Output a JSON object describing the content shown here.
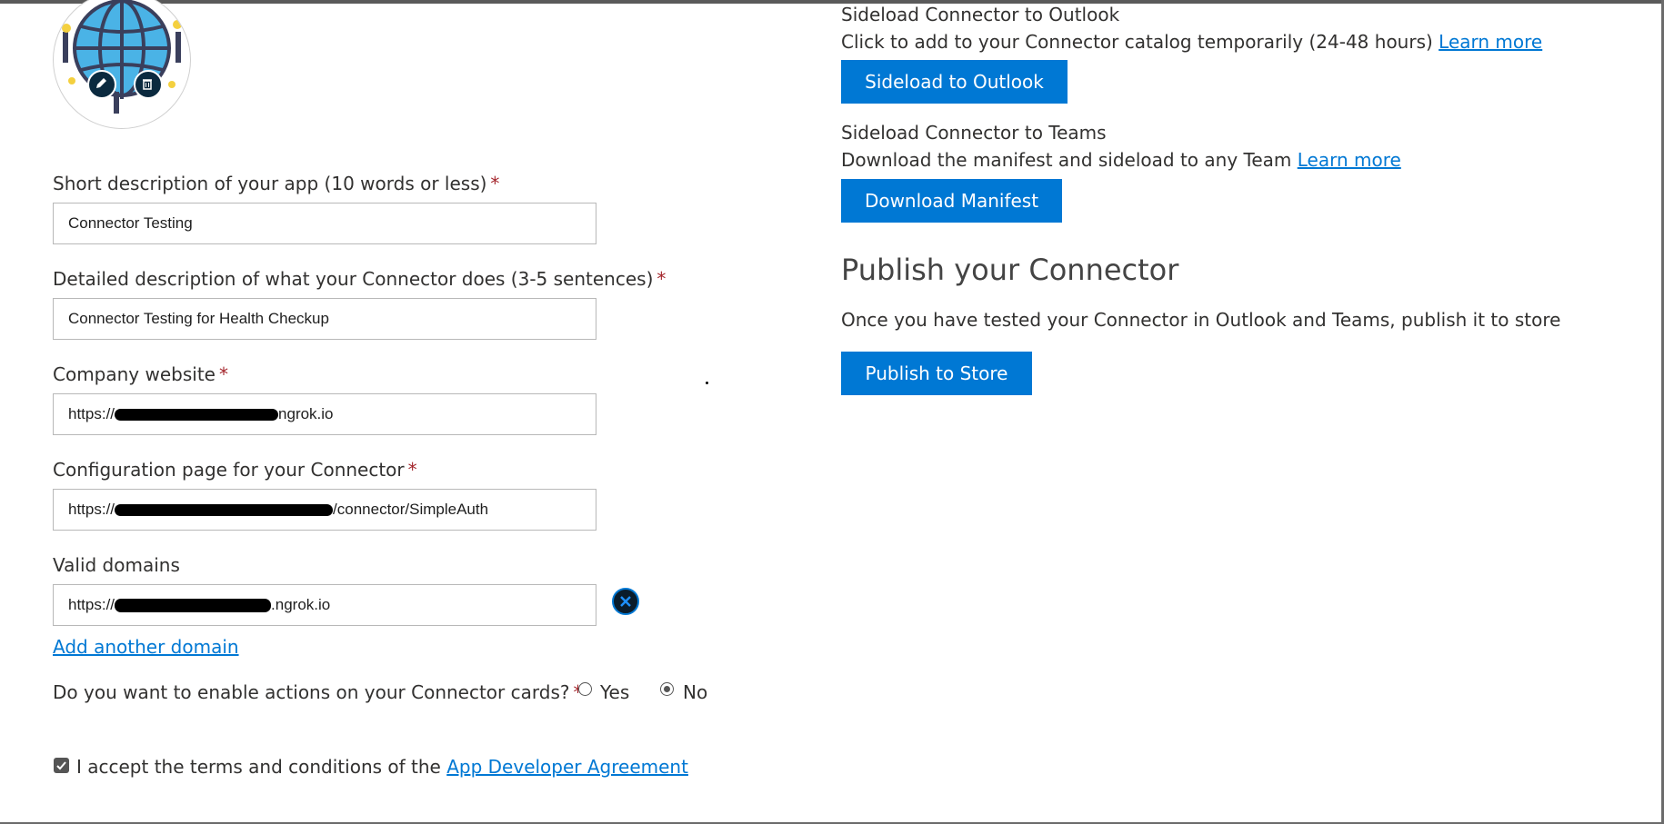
{
  "avatar": {
    "edit_icon": "pencil-icon",
    "delete_icon": "trash-icon"
  },
  "form": {
    "short_description": {
      "label": "Short description of your app (10 words or less)",
      "required": "*",
      "value": "Connector Testing"
    },
    "detailed_description": {
      "label": "Detailed description of what your Connector does (3-5 sentences)",
      "required": "*",
      "value": "Connector Testing for Health Checkup"
    },
    "company_website": {
      "label": "Company website",
      "required": "*",
      "prefix": "https://",
      "suffix": "ngrok.io"
    },
    "configuration_page": {
      "label": "Configuration page for your Connector",
      "required": "*",
      "prefix": "https://",
      "suffix": "/connector/SimpleAuth"
    },
    "valid_domains": {
      "label": "Valid domains",
      "prefix": "https://",
      "suffix": ".ngrok.io",
      "remove_icon": "close-circle-icon",
      "add_link": "Add another domain"
    },
    "actions_question": {
      "label": "Do you want to enable actions on your Connector cards?",
      "required": "*",
      "options": [
        "Yes",
        "No"
      ],
      "selected": "No"
    },
    "terms": {
      "text": "I accept the terms and conditions of the",
      "link": "App Developer Agreement",
      "checked": true
    }
  },
  "sideload_outlook": {
    "title": "Sideload Connector to Outlook",
    "description": "Click to add to your Connector catalog temporarily (24-48 hours)",
    "link": "Learn more",
    "button": "Sideload to Outlook"
  },
  "sideload_teams": {
    "title": "Sideload Connector to Teams",
    "description": "Download the manifest and sideload to any Team",
    "link": "Learn more",
    "button": "Download Manifest"
  },
  "publish": {
    "heading": "Publish your Connector",
    "description": "Once you have tested your Connector in Outlook and Teams, publish it to store",
    "button": "Publish to Store"
  },
  "colors": {
    "accent": "#0078d4",
    "required": "#a4262c"
  }
}
